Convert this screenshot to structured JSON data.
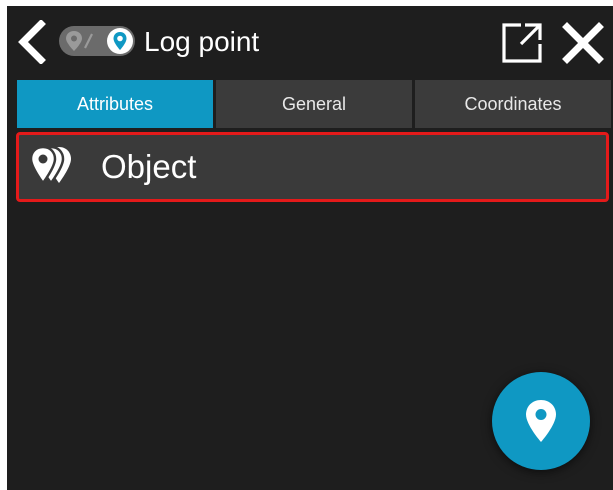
{
  "header": {
    "title": "Log point",
    "back_icon": "chevron-left-icon",
    "mode_toggle": {
      "left_icon": "route-pin-icon",
      "right_icon": "map-pin-icon",
      "selected": "right"
    },
    "open_external_icon": "open-external-icon",
    "close_icon": "close-icon"
  },
  "tabs": [
    {
      "label": "Attributes",
      "active": true
    },
    {
      "label": "General",
      "active": false
    },
    {
      "label": "Coordinates",
      "active": false
    }
  ],
  "list": {
    "items": [
      {
        "label": "Object",
        "icon": "stacked-pins-icon",
        "highlighted": true
      }
    ]
  },
  "fab": {
    "icon": "map-pin-icon"
  },
  "colors": {
    "background": "#1e1e1e",
    "accent": "#0f98c3",
    "tab_inactive": "#3b3b3b",
    "row_background": "#3a3a3a",
    "highlight_border": "#e41a1a",
    "text": "#ffffff"
  }
}
